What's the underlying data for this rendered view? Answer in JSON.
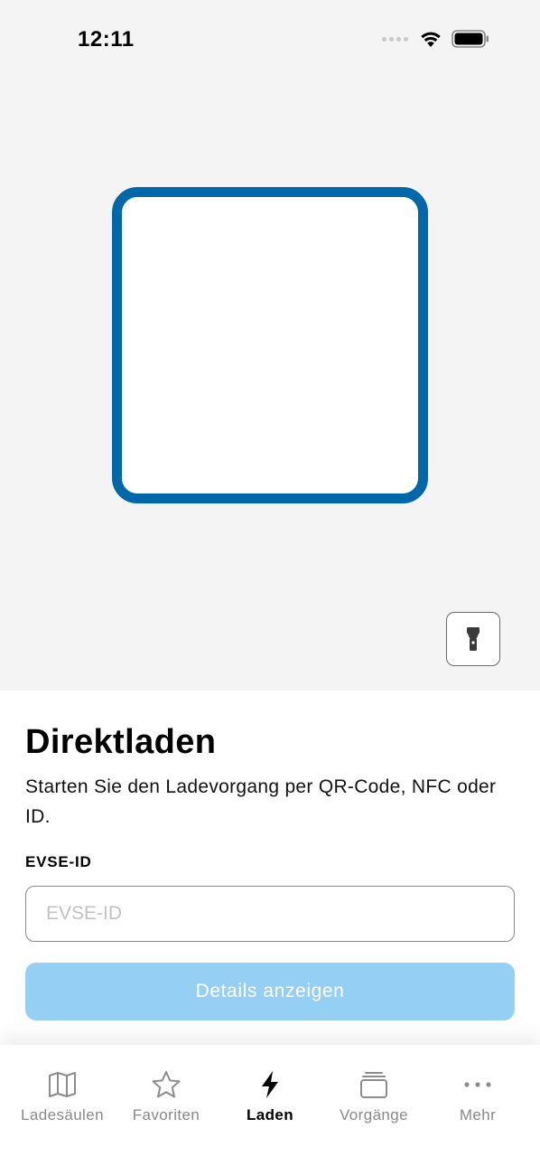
{
  "status_bar": {
    "time": "12:11",
    "icons": [
      "cellular-signal-icon",
      "wifi-icon",
      "battery-icon"
    ]
  },
  "scanner": {
    "frame_color": "#0068a8",
    "torch_icon": "flashlight-icon"
  },
  "direct_charge": {
    "title": "Direktladen",
    "description": "Starten Sie den Ladevorgang per QR-Code, NFC oder ID.",
    "field_label": "EVSE-ID",
    "field_placeholder": "EVSE-ID",
    "field_value": "",
    "button_label": "Details anzeigen",
    "button_color": "#95d0f4"
  },
  "tab_bar": {
    "active": "Laden",
    "items": [
      {
        "label": "Ladesäulen",
        "icon": "map-icon"
      },
      {
        "label": "Favoriten",
        "icon": "star-icon"
      },
      {
        "label": "Laden",
        "icon": "lightning-bolt-icon"
      },
      {
        "label": "Vorgänge",
        "icon": "stack-icon"
      },
      {
        "label": "Mehr",
        "icon": "more-dots-icon"
      }
    ]
  }
}
